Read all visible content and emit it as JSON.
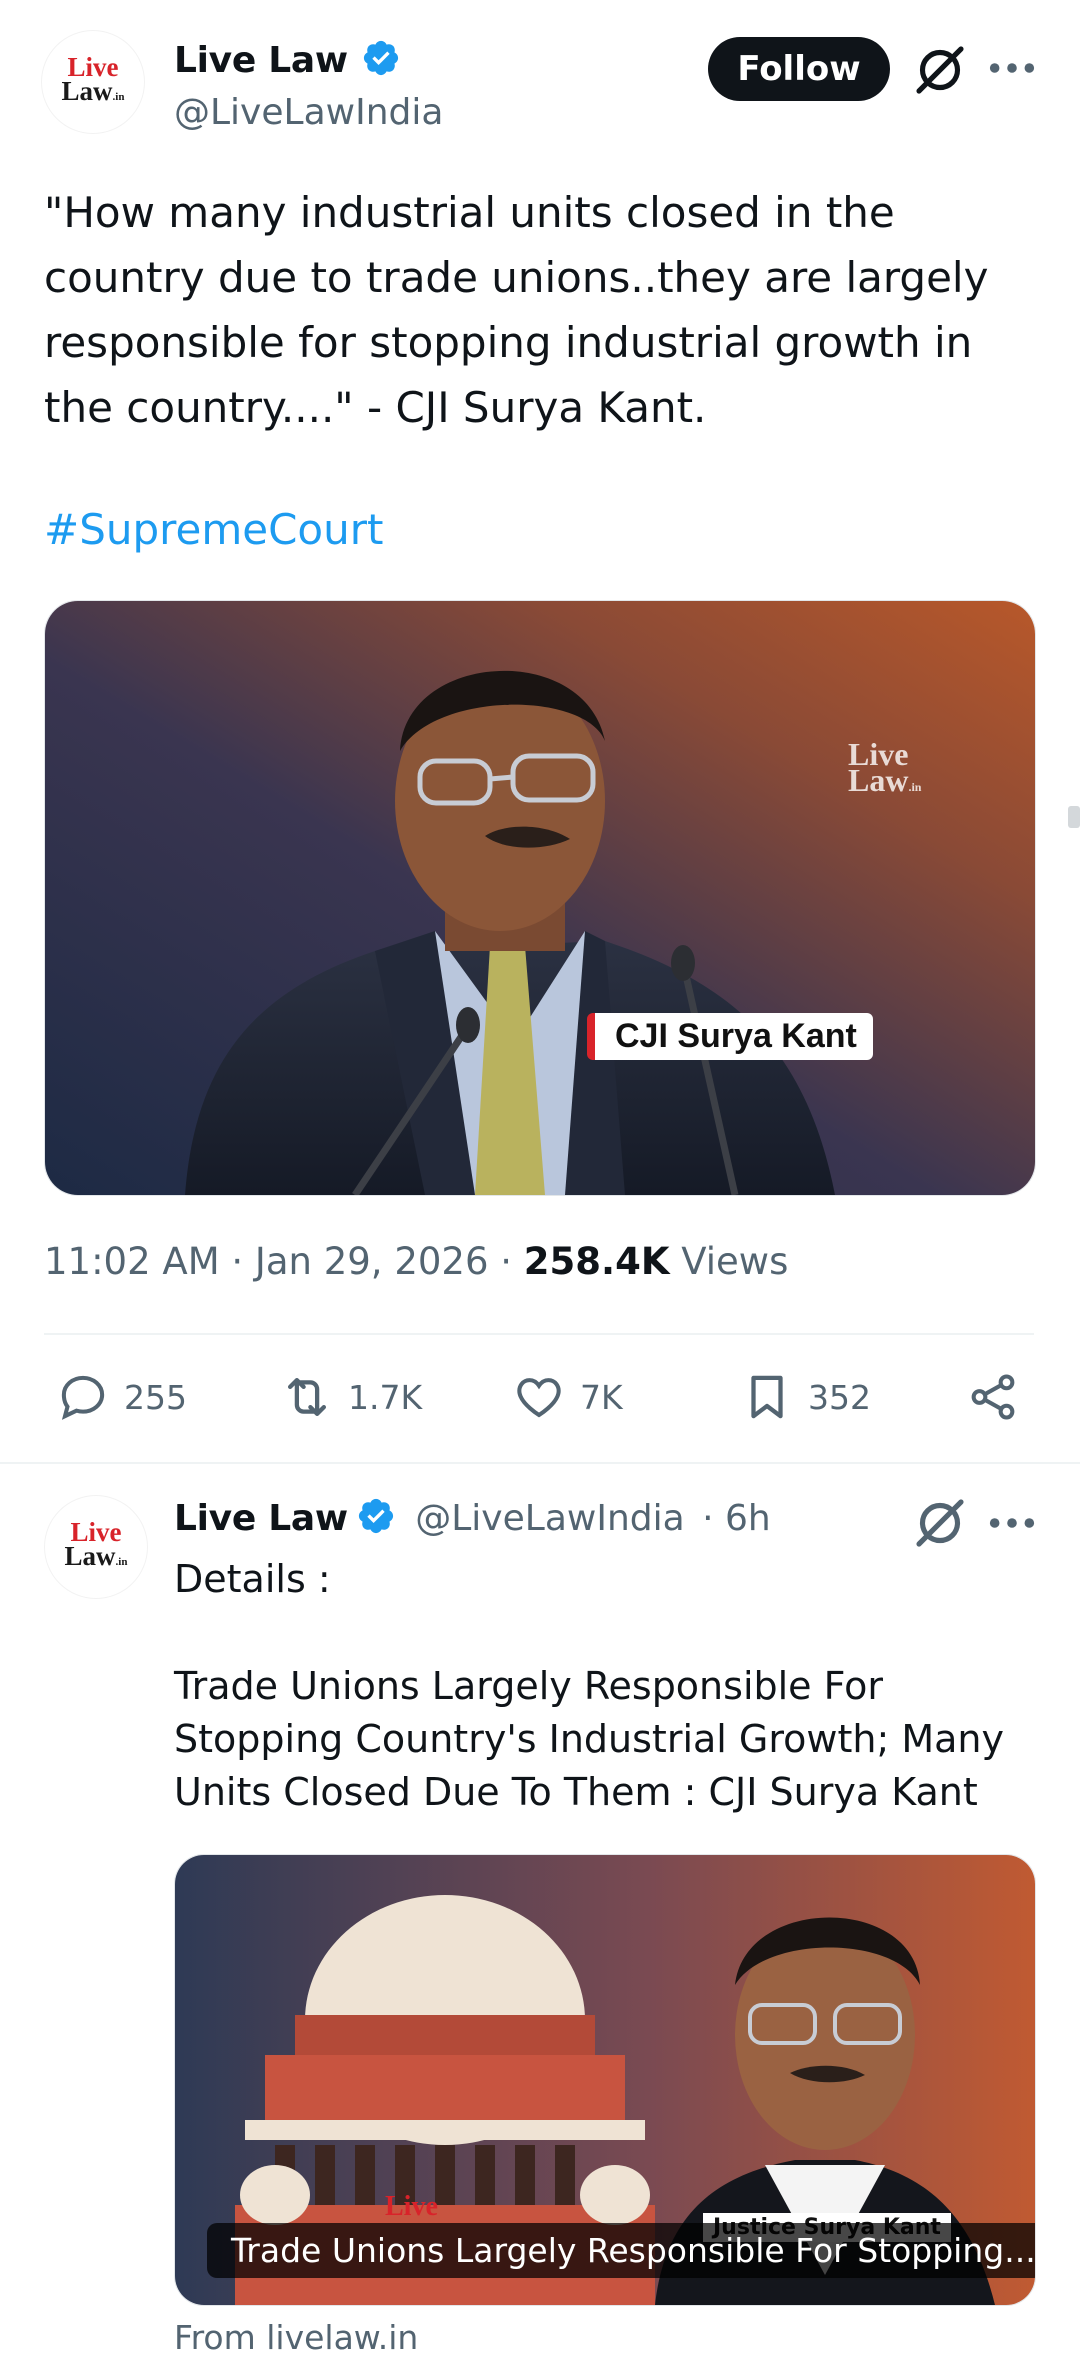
{
  "tweet": {
    "author_name": "Live Law",
    "author_handle": "@LiveLawIndia",
    "logo_line1": "Live",
    "logo_line2": "Law",
    "logo_suffix": ".in",
    "follow_label": "Follow",
    "text": "\"How many industrial units closed in the country due to trade unions..they are largely responsible for stopping industrial growth in the country....\" - CJI Surya Kant.",
    "hashtag": "#SupremeCourt",
    "image": {
      "watermark_line1": "Live",
      "watermark_line2": "Law",
      "watermark_suffix": ".in",
      "name_tag": "CJI Surya Kant"
    },
    "time": "11:02 AM",
    "date": "Jan 29, 2026",
    "sep": " · ",
    "views_count": "258.4K",
    "views_label": "Views",
    "actions": {
      "replies": "255",
      "reposts": "1.7K",
      "likes": "7K",
      "bookmarks": "352"
    }
  },
  "reply": {
    "author_name": "Live Law",
    "author_handle": "@LiveLawIndia",
    "time_ago": "· 6h",
    "line1": "Details :",
    "line2": "Trade Unions Largely Responsible For Stopping Country's Industrial Growth; Many Units Closed Due To Them : CJI Surya Kant",
    "card_caption": "Trade Unions Largely Responsible For Stopping...",
    "card_name_tag": "Justice Surya Kant",
    "card_logo": "Live",
    "card_source": "From livelaw.in"
  },
  "colors": {
    "accent": "#1d9bf0",
    "text_primary": "#0f1419",
    "text_secondary": "#536471",
    "logo_red": "#d8232a"
  },
  "icons": [
    "verified-badge-icon",
    "grok-icon",
    "more-icon",
    "reply-icon",
    "repost-icon",
    "like-icon",
    "bookmark-icon",
    "share-icon"
  ]
}
